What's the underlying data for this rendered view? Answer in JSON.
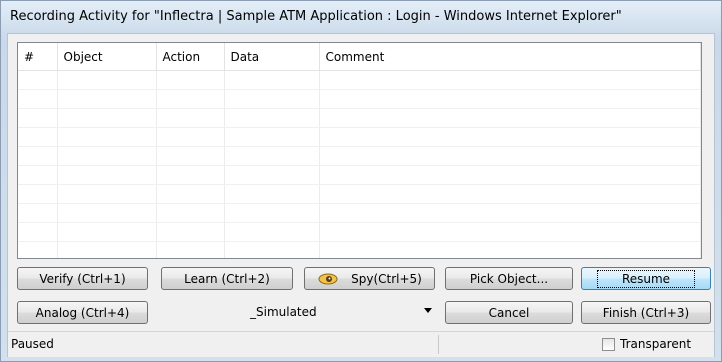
{
  "window": {
    "title": "Recording Activity for \"Inflectra | Sample ATM Application : Login - Windows Internet Explorer\""
  },
  "grid": {
    "columns": [
      "#",
      "Object",
      "Action",
      "Data",
      "Comment"
    ],
    "rows": []
  },
  "buttons": {
    "verify": "Verify (Ctrl+1)",
    "learn": "Learn (Ctrl+2)",
    "spy": "Spy(Ctrl+5)",
    "pick_object": "Pick Object...",
    "resume": "Resume",
    "analog": "Analog (Ctrl+4)",
    "cancel": "Cancel",
    "finish": "Finish (Ctrl+3)"
  },
  "mode_select": {
    "value": "_Simulated"
  },
  "statusbar": {
    "status": "Paused",
    "transparent_label": "Transparent",
    "transparent_checked": false
  },
  "icons": {
    "spy": "spy-eye-icon",
    "dropdown": "chevron-down-icon"
  }
}
